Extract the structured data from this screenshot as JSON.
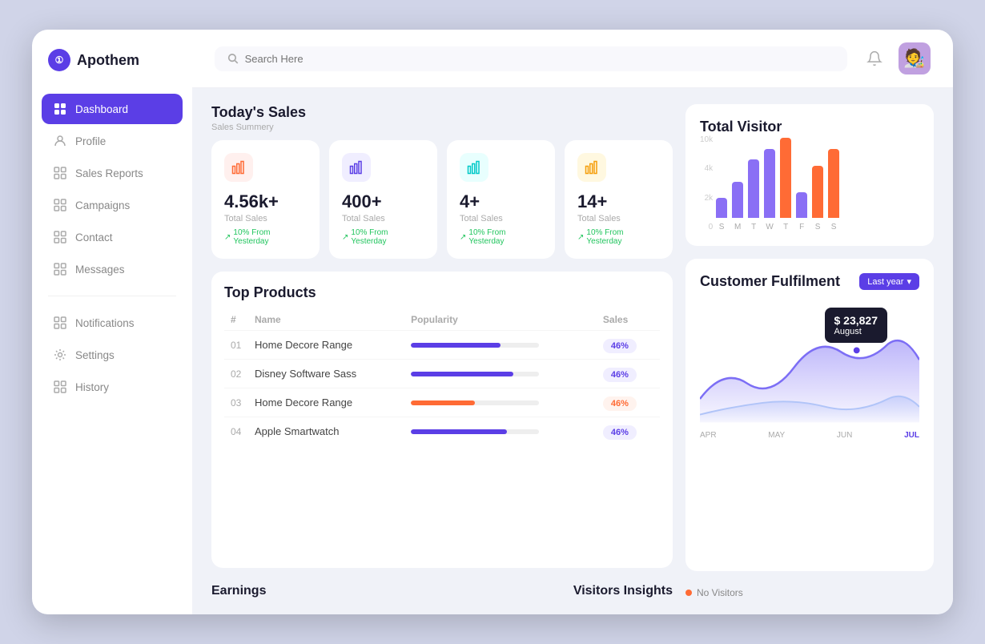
{
  "app": {
    "name": "Apothem"
  },
  "header": {
    "search_placeholder": "Search Here"
  },
  "sidebar": {
    "items": [
      {
        "id": "dashboard",
        "label": "Dashboard",
        "icon": "⊞",
        "active": true
      },
      {
        "id": "profile",
        "label": "Profile",
        "icon": "👤",
        "active": false
      },
      {
        "id": "sales-reports",
        "label": "Sales Reports",
        "icon": "⊞",
        "active": false
      },
      {
        "id": "campaigns",
        "label": "Campaigns",
        "icon": "⊞",
        "active": false
      },
      {
        "id": "contact",
        "label": "Contact",
        "icon": "⊞",
        "active": false
      },
      {
        "id": "messages",
        "label": "Messages",
        "icon": "⊞",
        "active": false
      }
    ],
    "items2": [
      {
        "id": "notifications",
        "label": "Notifications",
        "icon": "⊞",
        "active": false
      },
      {
        "id": "settings",
        "label": "Settings",
        "icon": "🔧",
        "active": false
      },
      {
        "id": "history",
        "label": "History",
        "icon": "⊞",
        "active": false
      }
    ]
  },
  "todaySales": {
    "title": "Today's Sales",
    "subtitle": "Sales Summery",
    "cards": [
      {
        "value": "4.56k+",
        "label": "Total Sales",
        "trend": "10% From Yesterday",
        "iconColor": "red",
        "icon": "📊"
      },
      {
        "value": "400+",
        "label": "Total Sales",
        "trend": "10% From Yesterday",
        "iconColor": "purple",
        "icon": "📈"
      },
      {
        "value": "4+",
        "label": "Total Sales",
        "trend": "10% From Yesterday",
        "iconColor": "teal",
        "icon": "📉"
      },
      {
        "value": "14+",
        "label": "Total Sales",
        "trend": "10% From Yesterday",
        "iconColor": "orange",
        "icon": "💰"
      }
    ]
  },
  "topProducts": {
    "title": "Top Products",
    "headers": [
      "#",
      "Name",
      "Popularity",
      "Sales"
    ],
    "rows": [
      {
        "num": "01",
        "name": "Home Decore Range",
        "popularity": 70,
        "sales": "46%",
        "barColor": "#5b3ee6",
        "badgeClass": ""
      },
      {
        "num": "02",
        "name": "Disney Software Sass",
        "popularity": 80,
        "sales": "46%",
        "barColor": "#5b3ee6",
        "badgeClass": ""
      },
      {
        "num": "03",
        "name": "Home Decore Range",
        "popularity": 50,
        "sales": "46%",
        "barColor": "#ff6b35",
        "badgeClass": "orange"
      },
      {
        "num": "04",
        "name": "Apple Smartwatch",
        "popularity": 75,
        "sales": "46%",
        "barColor": "#5b3ee6",
        "badgeClass": ""
      }
    ]
  },
  "totalVisitor": {
    "title": "Total  Visitor",
    "yLabels": [
      "10k",
      "4k",
      "2k",
      "0"
    ],
    "bars": [
      {
        "day": "S",
        "purple": 30,
        "orange": 0
      },
      {
        "day": "M",
        "purple": 50,
        "orange": 0
      },
      {
        "day": "T",
        "purple": 80,
        "orange": 0
      },
      {
        "day": "W",
        "purple": 95,
        "orange": 0
      },
      {
        "day": "T",
        "purple": 0,
        "orange": 110
      },
      {
        "day": "F",
        "purple": 40,
        "orange": 0
      },
      {
        "day": "S",
        "purple": 0,
        "orange": 75
      },
      {
        "day": "S",
        "purple": 0,
        "orange": 100
      }
    ]
  },
  "customerFulfilment": {
    "title": "Customer Fulfilment",
    "filterLabel": "Last year",
    "tooltip": {
      "amount": "$ 23,827",
      "month": "August"
    },
    "months": [
      "APR",
      "MAY",
      "JUN",
      "JUL"
    ],
    "activeMonth": "JUL"
  },
  "bottomSection": {
    "earnings": "Earnings",
    "visitorsInsights": "Visitors Insights",
    "noVisitors": "No Visitors"
  }
}
